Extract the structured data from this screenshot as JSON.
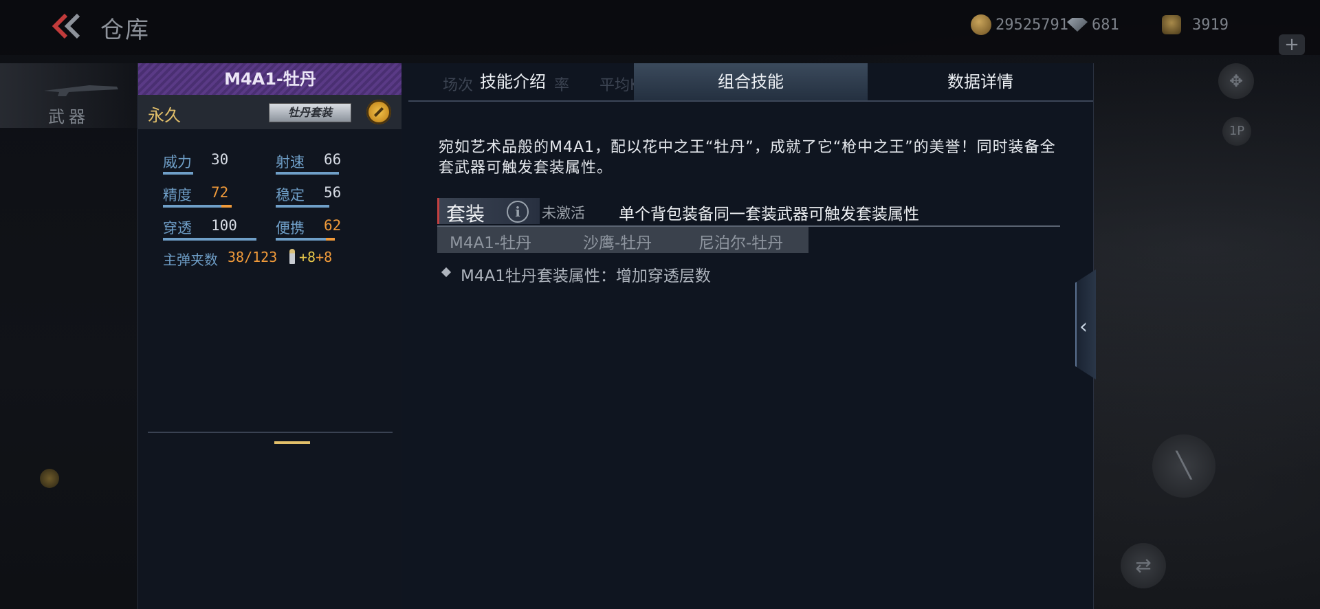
{
  "topbar": {
    "title": "仓库",
    "gold": "29525791",
    "gems": "681",
    "tickets": "3919"
  },
  "sidebar": {
    "tab_label": "武器"
  },
  "weapon": {
    "name": "M4A1-牡丹",
    "duration": "永久",
    "suit_badge": "牡丹套装",
    "stats": [
      {
        "label": "威力",
        "value": "30",
        "highlight": false
      },
      {
        "label": "射速",
        "value": "66",
        "highlight": false
      },
      {
        "label": "精度",
        "value": "72",
        "highlight": true
      },
      {
        "label": "稳定",
        "value": "56",
        "highlight": false
      },
      {
        "label": "穿透",
        "value": "100",
        "highlight": false
      },
      {
        "label": "便携",
        "value": "62",
        "highlight": true
      }
    ],
    "ammo_label": "主弹夹数",
    "ammo_value": "38/123",
    "ammo_bonus_1": "+8",
    "ammo_bonus_2": "+8"
  },
  "tabs": {
    "intro": "技能介绍",
    "combo": "组合技能",
    "data": "数据详情",
    "ghost_1": "场次",
    "ghost_2": "率",
    "ghost_3": "平均KDA",
    "active": "combo"
  },
  "content": {
    "description": "宛如艺术品般的M4A1，配以花中之王“牡丹”，成就了它“枪中之王”的美誉！同时装备全套武器可触发套装属性。",
    "suit_tag": "套装",
    "suit_status": "未激活",
    "suit_rule": "单个背包装备同一套装武器可触发套装属性",
    "members": [
      "M4A1-牡丹",
      "沙鹰-牡丹",
      "尼泊尔-牡丹"
    ],
    "attribute": "M4A1牡丹套装属性：增加穿透层数"
  },
  "colors": {
    "accent_gold": "#e3c06a",
    "stat_blue": "#6f9fc8",
    "stat_orange": "#f09a3a",
    "header_purple": "#5a3a86"
  }
}
